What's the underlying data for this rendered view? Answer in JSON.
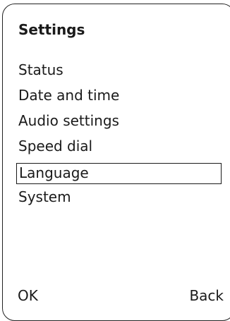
{
  "screen": {
    "title": "Settings"
  },
  "menu": {
    "items": [
      {
        "label": "Status"
      },
      {
        "label": "Date and time"
      },
      {
        "label": "Audio settings"
      },
      {
        "label": "Speed dial"
      },
      {
        "label": "Language",
        "selected": true
      },
      {
        "label": "System"
      }
    ]
  },
  "softkeys": {
    "left_label": "OK",
    "right_label": "Back"
  }
}
